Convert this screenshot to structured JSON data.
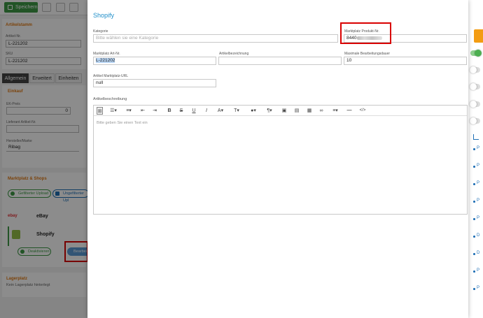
{
  "background": {
    "toolbar": {
      "save_label": "Speichern"
    },
    "stammdaten": {
      "title": "Artikelstamm",
      "artikelnr_label": "Artikel-Nr.",
      "artikelnr_value": "L-221202",
      "sku_label": "SKU",
      "sku_value": "L-221202"
    },
    "tabs": [
      "Allgemein",
      "Erweitert",
      "Einheiten"
    ],
    "einkauf": {
      "title": "Einkauf",
      "ek_label": "EK-Preis",
      "ek_value": "0",
      "lieferant_label": "Lieferant Artikel-Nr.",
      "hersteller_label": "Hersteller/Marke",
      "hersteller_value": "Ribag"
    },
    "marktplatz": {
      "title": "Marktplatz & Shops",
      "btn_gefiltert": "Gefilterter Upload",
      "btn_ungefiltert": "Ungefilterter Upl",
      "shops": [
        "eBay",
        "Shopify"
      ],
      "ebay_logo": "ebay",
      "deaktivieren": "Deaktivieren",
      "bearbeiten": "Bearbei"
    },
    "lagerplatz": {
      "title": "Lagerplatz",
      "text": "Kein Lagerplatz hinterlegt"
    },
    "right_links": [
      "P",
      "P",
      "P",
      "P",
      "P",
      "D",
      "D",
      "P",
      "P"
    ]
  },
  "modal": {
    "title": "Shopify",
    "kategorie_label": "Kategorie",
    "kategorie_placeholder": "Bitte wählen sie eine Kategorie",
    "produktnr_label": "Marktplatz Produkt-Nr.",
    "produktnr_value": "8440",
    "artnr_label": "Marktplatz Art-Nr.",
    "artnr_value": "L-221202",
    "bezeichnung_label": "Artikelbezeichnung",
    "bezeichnung_value": "",
    "dauer_label": "Maximale Bearbeitungsdauer",
    "dauer_value": "10",
    "url_label": "Artikel Marktplatz-URL",
    "url_value": "null",
    "beschreibung_label": "Artikelbeschreibung",
    "editor_placeholder": "Bitte geben Sie einen Text ein"
  },
  "colors": {
    "accent": "#1f8ec9",
    "green": "#3e9a45",
    "orange": "#e07a14",
    "highlight": "#d90000"
  }
}
